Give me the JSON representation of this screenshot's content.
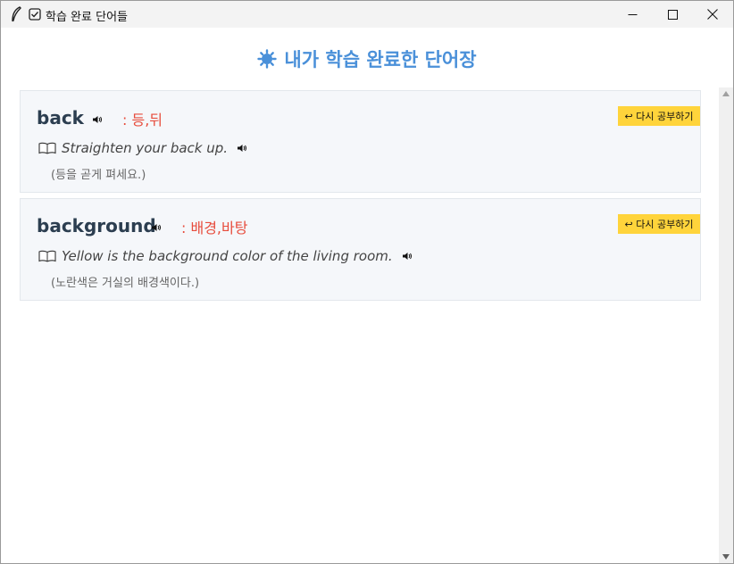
{
  "window": {
    "title": "학습 완료 단어들",
    "icons": [
      "feather-icon",
      "checkbox-icon"
    ],
    "controls": [
      "minimize-icon",
      "maximize-icon",
      "close-icon"
    ]
  },
  "heading": {
    "text": "내가 학습 완료한 단어장",
    "icon": "sun-icon",
    "color": "#4a90d9"
  },
  "cards": [
    {
      "word": "back",
      "meaning": ": 등,뒤",
      "example": "Straighten your back up.",
      "translation": "(등을 곧게 펴세요.)",
      "button": "↩ 다시 공부하기"
    },
    {
      "word": "background",
      "meaning": ": 배경,바탕",
      "example": "Yellow is the background color of the living room.",
      "translation": "(노란색은 거실의 배경색이다.)",
      "button": "↩ 다시 공부하기"
    }
  ],
  "colors": {
    "meaning": "#e74c3c",
    "button": "#ffd43b",
    "card_bg": "#f5f7fa"
  }
}
